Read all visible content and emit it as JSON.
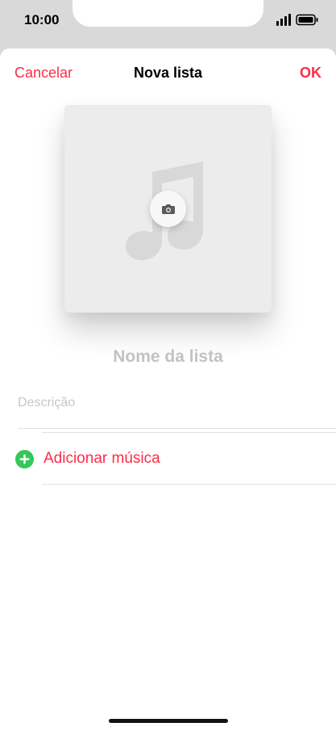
{
  "status_bar": {
    "time": "10:00"
  },
  "nav": {
    "cancel": "Cancelar",
    "title": "Nova lista",
    "ok": "OK"
  },
  "artwork": {
    "icon": "music-note-icon",
    "camera_icon": "camera-icon"
  },
  "form": {
    "list_name_placeholder": "Nome da lista",
    "description_placeholder": "Descrição",
    "add_music_label": "Adicionar música"
  },
  "colors": {
    "accent": "#fa2d48",
    "add_green": "#34c759",
    "placeholder": "#c2c2c2",
    "sheet_background": "#ffffff",
    "device_background": "#d9d9d9"
  }
}
